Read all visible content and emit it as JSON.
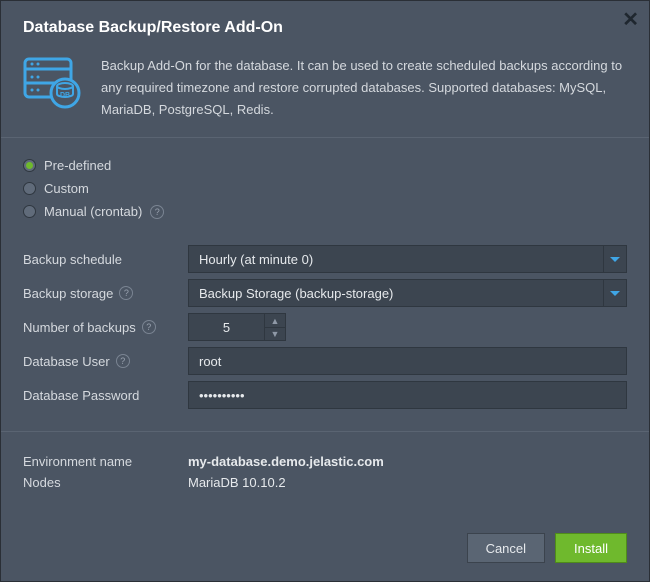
{
  "dialog_title": "Database Backup/Restore Add-On",
  "description": "Backup Add-On for the database. It can be used to create scheduled backups according to any required timezone and restore corrupted databases. Supported databases: MySQL, MariaDB, PostgreSQL, Redis.",
  "schedule_type": {
    "options": [
      {
        "label": "Pre-defined",
        "selected": true,
        "has_help": false
      },
      {
        "label": "Custom",
        "selected": false,
        "has_help": false
      },
      {
        "label": "Manual (crontab)",
        "selected": false,
        "has_help": true
      }
    ]
  },
  "fields": {
    "backup_schedule": {
      "label": "Backup schedule",
      "value": "Hourly (at minute 0)"
    },
    "backup_storage": {
      "label": "Backup storage",
      "value": "Backup Storage (backup-storage)",
      "has_help": true
    },
    "number_of_backups": {
      "label": "Number of backups",
      "value": "5",
      "has_help": true
    },
    "db_user": {
      "label": "Database User",
      "value": "root",
      "has_help": true
    },
    "db_password": {
      "label": "Database Password",
      "value": "••••••••••"
    }
  },
  "environment": {
    "name_label": "Environment name",
    "name_value": "my-database.demo.jelastic.com",
    "nodes_label": "Nodes",
    "nodes_value": "MariaDB 10.10.2"
  },
  "buttons": {
    "cancel": "Cancel",
    "install": "Install"
  }
}
